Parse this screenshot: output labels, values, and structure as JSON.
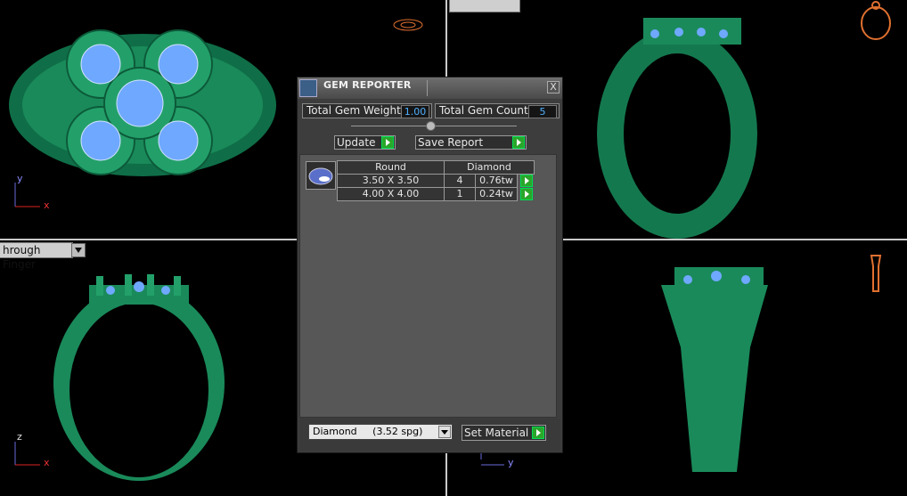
{
  "viewports": {
    "top_left": {
      "label": "",
      "axis_a": "y",
      "axis_b": "x"
    },
    "top_right": {
      "label": ""
    },
    "bottom_left": {
      "label": "hrough Finger",
      "axis_a": "z",
      "axis_b": "x"
    },
    "bottom_right": {
      "label": "",
      "axis_a": "",
      "axis_b": "y"
    }
  },
  "colors": {
    "ring": "#1a8a5a",
    "ring_light": "#2fbf80",
    "gem": "#6fa8ff",
    "axis_x": "#d22",
    "axis_y": "#55a",
    "dialog_bg": "#3d3d3d"
  },
  "dialog": {
    "title": "GEM REPORTER",
    "close_label": "X",
    "total_weight_label": "Total Gem Weight",
    "total_weight_value": "1.00",
    "total_count_label": "Total Gem Count",
    "total_count_value": "5",
    "update_label": "Update",
    "save_report_label": "Save Report",
    "table": {
      "headers": [
        "Round",
        "Diamond"
      ],
      "rows": [
        {
          "size": "3.50 X 3.50",
          "count": "4",
          "weight": "0.76tw"
        },
        {
          "size": "4.00 X 4.00",
          "count": "1",
          "weight": "0.24tw"
        }
      ]
    },
    "material_select": "Diamond     (3.52 spg)",
    "set_material_label": "Set Material"
  }
}
